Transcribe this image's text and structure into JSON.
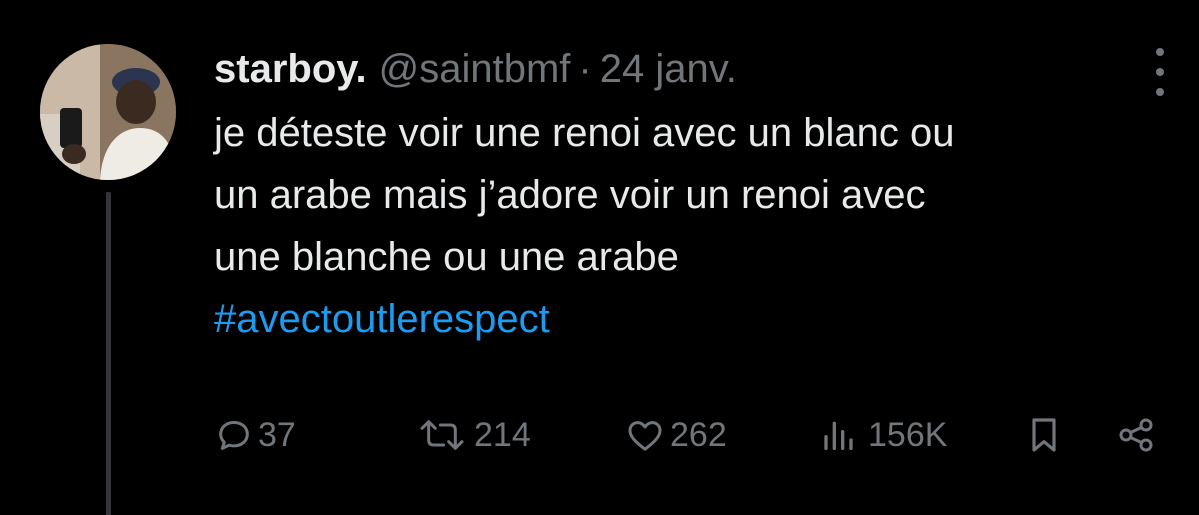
{
  "tweet": {
    "display_name": "starboy.",
    "handle": "@saintbmf",
    "separator": "·",
    "date": "24 janv.",
    "text_lines": [
      "je déteste voir une renoi avec un blanc ou",
      "un arabe mais j’adore voir un renoi avec",
      "une blanche ou une arabe"
    ],
    "hashtag": "#avectoutlerespect"
  },
  "actions": {
    "reply": {
      "icon": "reply-icon",
      "count": "37"
    },
    "retweet": {
      "icon": "retweet-icon",
      "count": "214"
    },
    "like": {
      "icon": "heart-icon",
      "count": "262"
    },
    "views": {
      "icon": "views-icon",
      "count": "156K"
    },
    "bookmark": {
      "icon": "bookmark-icon"
    },
    "share": {
      "icon": "share-icon"
    }
  },
  "colors": {
    "background": "#000000",
    "text_primary": "#e7e9ea",
    "text_secondary": "#71767b",
    "link": "#1d9bf0"
  }
}
